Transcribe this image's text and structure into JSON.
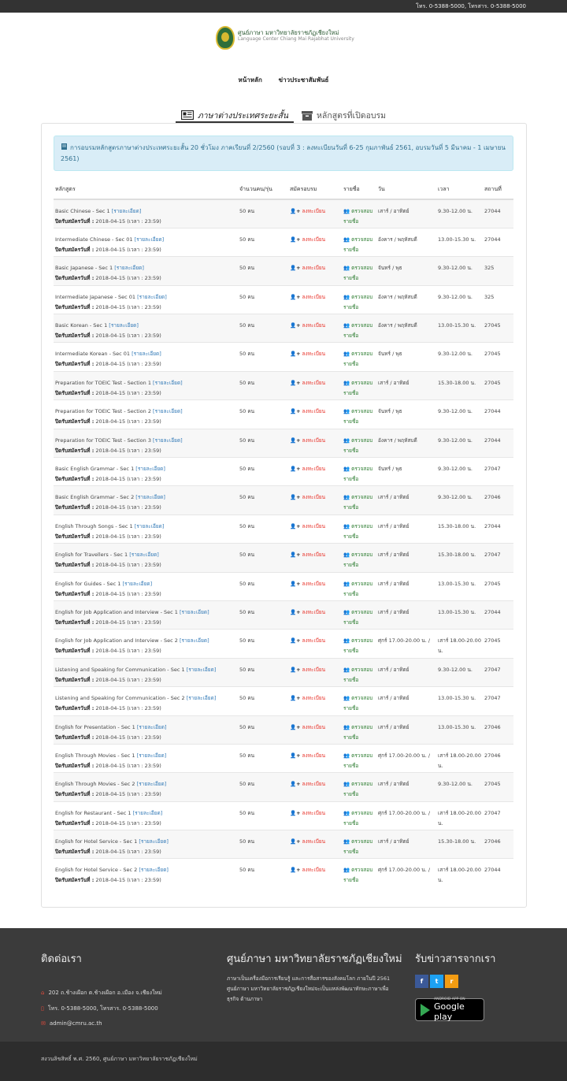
{
  "topbar": {
    "phone": "โทร. 0-5388-5000, โทรสาร. 0-5388-5000"
  },
  "header": {
    "brand_th": "ศูนย์ภาษา มหาวิทยาลัยราชภัฏเชียงใหม่",
    "brand_en": "Language Center Chiang Mai Rajabhat University"
  },
  "nav": {
    "home": "หน้าหลัก",
    "news": "ข่าวประชาสัมพันธ์"
  },
  "tabs": {
    "short_course": "ภาษาต่างประเทศระยะสั้น",
    "open_course": "หลักสูตรที่เปิดอบรม"
  },
  "notice": "การอบรมหลักสูตรภาษาต่างประเทศระยะสั้น 20 ชั่วโมง ภาคเรียนที่ 2/2560 (รอบที่ 3 : ลงทะเบียนวันที่ 6-25 กุมภาพันธ์ 2561, อบรมวันที่ 5 มีนาคม - 1 เมษายน 2561)",
  "table": {
    "headers": [
      "หลักสูตร",
      "จำนวนคน/รุ่น",
      "สมัครอบรม",
      "รายชื่อ",
      "วัน",
      "เวลา",
      "สถานที่"
    ],
    "detail_label": "[รายละเอียด]",
    "deadline_label": "ปิดรับสมัครวันที่ :",
    "deadline_value": "2018-04-15 (เวลา : 23:59)",
    "register_label": "ลงทะเบียน",
    "check_label": "ตรวจสอบรายชื่อ",
    "rows": [
      {
        "course": "Basic Chinese - Sec 1",
        "seats": "50 คน",
        "day": "เสาร์ / อาทิตย์",
        "time": "9.30-12.00 น.",
        "room": "27044"
      },
      {
        "course": "Intermediate Chinese - Sec 01",
        "seats": "50 คน",
        "day": "อังคาร / พฤหัสบดี",
        "time": "13.00-15.30 น.",
        "room": "27044"
      },
      {
        "course": "Basic Japanese - Sec 1",
        "seats": "50 คน",
        "day": "จันทร์ / พุธ",
        "time": "9.30-12.00 น.",
        "room": "325"
      },
      {
        "course": "Intermediate Japanese - Sec 01",
        "seats": "50 คน",
        "day": "อังคาร / พฤหัสบดี",
        "time": "9.30-12.00 น.",
        "room": "325"
      },
      {
        "course": "Basic Korean - Sec 1",
        "seats": "50 คน",
        "day": "อังคาร / พฤหัสบดี",
        "time": "13.00-15.30 น.",
        "room": "27045"
      },
      {
        "course": "Intermediate Korean - Sec 01",
        "seats": "50 คน",
        "day": "จันทร์ / พุธ",
        "time": "9.30-12.00 น.",
        "room": "27045"
      },
      {
        "course": "Preparation for TOEIC Test - Section 1",
        "seats": "50 คน",
        "day": "เสาร์ / อาทิตย์",
        "time": "15.30-18.00 น.",
        "room": "27045"
      },
      {
        "course": "Preparation for TOEIC Test - Section 2",
        "seats": "50 คน",
        "day": "จันทร์ / พุธ",
        "time": "9.30-12.00 น.",
        "room": "27044"
      },
      {
        "course": "Preparation for TOEIC Test - Section 3",
        "seats": "50 คน",
        "day": "อังคาร / พฤหัสบดี",
        "time": "9.30-12.00 น.",
        "room": "27044"
      },
      {
        "course": "Basic English Grammar - Sec 1",
        "seats": "50 คน",
        "day": "จันทร์ / พุธ",
        "time": "9.30-12.00 น.",
        "room": "27047"
      },
      {
        "course": "Basic English Grammar - Sec 2",
        "seats": "50 คน",
        "day": "เสาร์ / อาทิตย์",
        "time": "9.30-12.00 น.",
        "room": "27046"
      },
      {
        "course": "English Through Songs - Sec 1",
        "seats": "50 คน",
        "day": "เสาร์ / อาทิตย์",
        "time": "15.30-18.00 น.",
        "room": "27044"
      },
      {
        "course": "English for Travellers - Sec 1",
        "seats": "50 คน",
        "day": "เสาร์ / อาทิตย์",
        "time": "15.30-18.00 น.",
        "room": "27047"
      },
      {
        "course": "English for Guides - Sec 1",
        "seats": "50 คน",
        "day": "เสาร์ / อาทิตย์",
        "time": "13.00-15.30 น.",
        "room": "27045"
      },
      {
        "course": "English for Job Application and Interview - Sec 1",
        "seats": "50 คน",
        "day": "เสาร์ / อาทิตย์",
        "time": "13.00-15.30 น.",
        "room": "27044"
      },
      {
        "course": "English for Job Application and Interview - Sec 2",
        "seats": "50 คน",
        "day": "ศุกร์ 17.00-20.00 น. /",
        "time": "เสาร์ 18.00-20.00 น.",
        "room": "27045"
      },
      {
        "course": "Listening and Speaking for Communication - Sec 1",
        "seats": "50 คน",
        "day": "เสาร์ / อาทิตย์",
        "time": "9.30-12.00 น.",
        "room": "27047"
      },
      {
        "course": "Listening and Speaking for Communication - Sec 2",
        "seats": "50 คน",
        "day": "เสาร์ / อาทิตย์",
        "time": "13.00-15.30 น.",
        "room": "27047"
      },
      {
        "course": "English for Presentation - Sec 1",
        "seats": "50 คน",
        "day": "เสาร์ / อาทิตย์",
        "time": "13.00-15.30 น.",
        "room": "27046"
      },
      {
        "course": "English Through Movies - Sec 1",
        "seats": "50 คน",
        "day": "ศุกร์ 17.00-20.00 น. /",
        "time": "เสาร์ 18.00-20.00 น.",
        "room": "27046"
      },
      {
        "course": "English Through Movies - Sec 2",
        "seats": "50 คน",
        "day": "เสาร์ / อาทิตย์",
        "time": "9.30-12.00 น.",
        "room": "27045"
      },
      {
        "course": "English for Restaurant - Sec 1",
        "seats": "50 คน",
        "day": "ศุกร์ 17.00-20.00 น. /",
        "time": "เสาร์ 18.00-20.00 น.",
        "room": "27047"
      },
      {
        "course": "English for Hotel Service - Sec 1",
        "seats": "50 คน",
        "day": "เสาร์ / อาทิตย์",
        "time": "15.30-18.00 น.",
        "room": "27046"
      },
      {
        "course": "English for Hotel Service - Sec 2",
        "seats": "50 คน",
        "day": "ศุกร์ 17.00-20.00 น. /",
        "time": "เสาร์ 18.00-20.00 น.",
        "room": "27044"
      }
    ]
  },
  "footer": {
    "contact_title": "ติดต่อเรา",
    "address": "202 ถ.ช้างเผือก ต.ช้างเผือก อ.เมือง จ.เชียงใหม่",
    "phone": "โทร. 0-5388-5000, โทรสาร. 0-5388-5000",
    "email": "admin@cmru.ac.th",
    "about_title": "ศูนย์ภาษา มหาวิทยาลัยราชภัฏเชียงใหม่",
    "about_text": "ภาษาเป็นเครื่องมือการเรียนรู้ และการสื่อสารของสังคมโลก ภายในปี 2561 ศูนย์ภาษา มหาวิทยาลัยราชภัฏเชียงใหม่จะเป็นแหล่งพัฒนาทักษะภาษาเพื่อธุรกิจ ด้านภาษา",
    "news_title": "รับข่าวสารจากเรา",
    "social": {
      "facebook": "f",
      "twitter": "t",
      "rss": "r"
    },
    "gp_small": "ANDROID APP ON",
    "gp_big": "Google play",
    "copyright": "สงวนลิขสิทธิ์ พ.ศ. 2560, ศูนย์ภาษา มหาวิทยาลัยราชภัฏเชียงใหม่"
  },
  "colors": {
    "topbar": "#333333",
    "footer": "#3b3b3b",
    "register": "#e8332a",
    "check": "#2e7d32",
    "notice_bg": "#d9edf7",
    "facebook": "#3b5998",
    "twitter": "#1da1f2",
    "rss": "#f39c12"
  }
}
